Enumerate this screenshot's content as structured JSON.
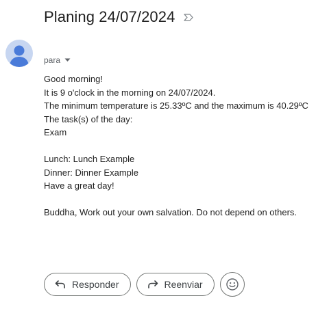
{
  "email": {
    "subject": "Planing 24/07/2024",
    "sender": "para",
    "icons": {
      "label": "label-important-icon",
      "avatar": "person-avatar-icon",
      "sender_menu": "caret-down-icon",
      "reply": "reply-arrow-icon",
      "forward": "forward-arrow-icon",
      "emoji": "smiley-icon"
    },
    "body": {
      "greeting": "Good morning!",
      "time_line": "It is 9 o'clock in the morning on 24/07/2024.",
      "temperature_line": "The minimum temperature is 25.33ºC and the maximum is 40.29ºC",
      "tasks_heading": "The task(s) of the day:",
      "task": "Exam",
      "lunch": "Lunch: Lunch Example",
      "dinner": "Dinner: Dinner Example",
      "closing": "Have a great day!",
      "quote": "Buddha, Work out your own salvation. Do not depend on others."
    }
  },
  "actions": {
    "reply_label": "Responder",
    "forward_label": "Reenviar"
  },
  "colors": {
    "avatar_bg": "#c7d6f1",
    "avatar_fg": "#4a7bd9",
    "border": "#747775"
  }
}
